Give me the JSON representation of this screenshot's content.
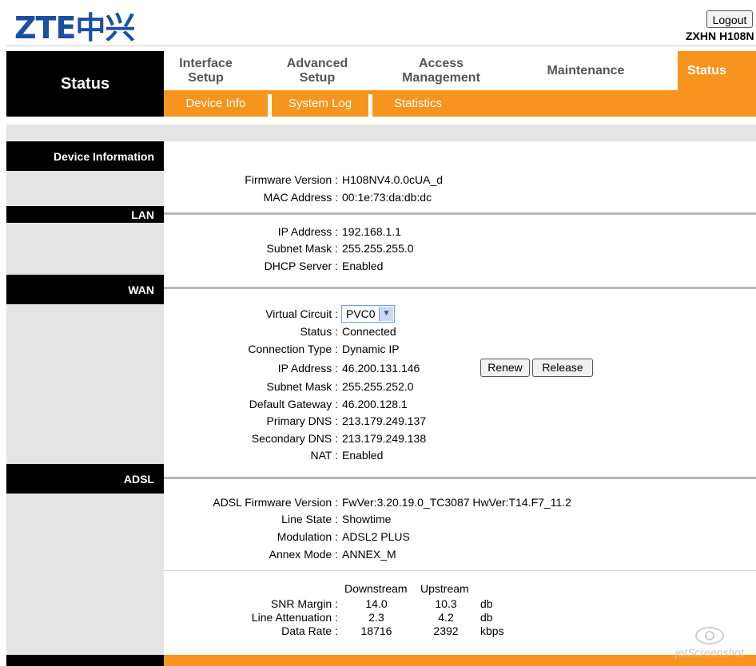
{
  "header": {
    "logo": "ZTE中兴",
    "logout_label": "Logout",
    "model": "ZXHN H108N"
  },
  "nav": {
    "section_title": "Status",
    "items": [
      {
        "label": "Interface Setup"
      },
      {
        "label": "Advanced Setup"
      },
      {
        "label": "Access Management"
      },
      {
        "label": "Maintenance"
      },
      {
        "label": "Status",
        "active": true
      }
    ],
    "sub_items": [
      "Device Info",
      "System Log",
      "Statistics"
    ]
  },
  "device_info": {
    "title": "Device Information",
    "firmware_label": "Firmware Version :",
    "firmware_value": "H108NV4.0.0cUA_d",
    "mac_label": "MAC Address :",
    "mac_value": "00:1e:73:da:db:dc"
  },
  "lan": {
    "title": "LAN",
    "ip_label": "IP Address :",
    "ip_value": "192.168.1.1",
    "mask_label": "Subnet Mask :",
    "mask_value": "255.255.255.0",
    "dhcp_label": "DHCP Server :",
    "dhcp_value": "Enabled"
  },
  "wan": {
    "title": "WAN",
    "vc_label": "Virtual Circuit :",
    "vc_value": "PVC0",
    "status_label": "Status :",
    "status_value": "Connected",
    "conn_label": "Connection Type :",
    "conn_value": "Dynamic IP",
    "ip_label": "IP Address :",
    "ip_value": "46.200.131.146",
    "renew_label": "Renew",
    "release_label": "Release",
    "mask_label": "Subnet Mask :",
    "mask_value": "255.255.252.0",
    "gw_label": "Default Gateway :",
    "gw_value": "46.200.128.1",
    "dns1_label": "Primary DNS :",
    "dns1_value": "213.179.249.137",
    "dns2_label": "Secondary DNS :",
    "dns2_value": "213.179.249.138",
    "nat_label": "NAT :",
    "nat_value": "Enabled"
  },
  "adsl": {
    "title": "ADSL",
    "fw_label": "ADSL Firmware Version :",
    "fw_value": "FwVer:3.20.19.0_TC3087 HwVer:T14.F7_11.2",
    "line_label": "Line State :",
    "line_value": "Showtime",
    "mod_label": "Modulation :",
    "mod_value": "ADSL2 PLUS",
    "annex_label": "Annex Mode :",
    "annex_value": "ANNEX_M",
    "stats": {
      "col_down": "Downstream",
      "col_up": "Upstream",
      "rows": [
        {
          "label": "SNR Margin :",
          "down": "14.0",
          "up": "10.3",
          "unit": "db"
        },
        {
          "label": "Line Attenuation :",
          "down": "2.3",
          "up": "4.2",
          "unit": "db"
        },
        {
          "label": "Data Rate :",
          "down": "18716",
          "up": "2392",
          "unit": "kbps"
        }
      ]
    }
  },
  "watermark": "jetScreenshot"
}
